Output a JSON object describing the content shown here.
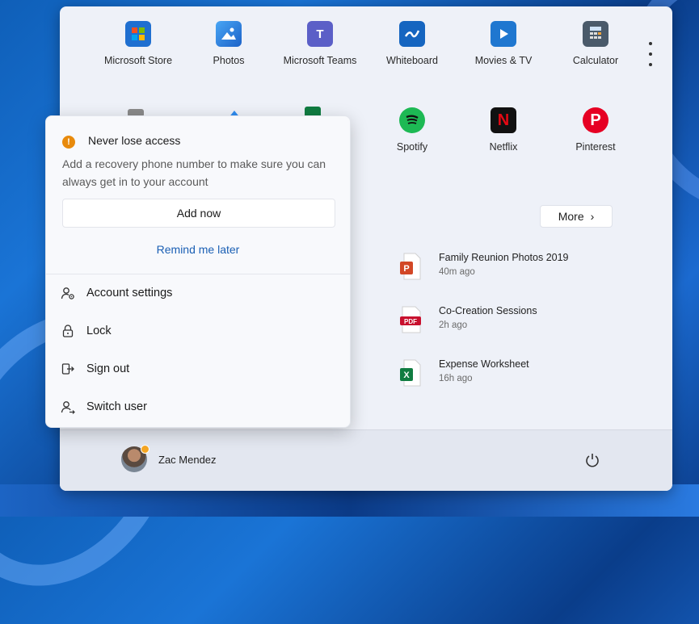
{
  "pinned_apps": [
    {
      "label": "Microsoft Store",
      "icon": "microsoft-store-icon",
      "color": "#1f6fd0"
    },
    {
      "label": "Photos",
      "icon": "photos-icon",
      "color": "#2b7fe0"
    },
    {
      "label": "Microsoft Teams",
      "icon": "teams-icon",
      "color": "#5b5fc7"
    },
    {
      "label": "Whiteboard",
      "icon": "whiteboard-icon",
      "color": "#1565c0"
    },
    {
      "label": "Movies & TV",
      "icon": "movies-tv-icon",
      "color": "#1f77d0"
    },
    {
      "label": "Calculator",
      "icon": "calculator-icon",
      "color": "#4a5a6a"
    },
    {
      "label": "Spotify",
      "icon": "spotify-icon",
      "color": "#1db954"
    },
    {
      "label": "Netflix",
      "icon": "netflix-icon",
      "color": "#e50914"
    },
    {
      "label": "Pinterest",
      "icon": "pinterest-icon",
      "color": "#e60023"
    }
  ],
  "more_button": {
    "label": "More",
    "icon": "chevron-right-icon"
  },
  "recommended": [
    {
      "name": "Family Reunion Photos 2019",
      "time": "40m ago",
      "icon": "powerpoint-file-icon"
    },
    {
      "name": "Co-Creation Sessions",
      "time": "2h ago",
      "icon": "pdf-file-icon"
    },
    {
      "name": "Expense Worksheet",
      "time": "16h ago",
      "icon": "excel-file-icon"
    }
  ],
  "user": {
    "name": "Zac Mendez"
  },
  "account_flyout": {
    "title": "Never lose access",
    "description": "Add a recovery phone number to make sure you can always get in to your account",
    "add_now": "Add now",
    "remind_later": "Remind me later",
    "menu": [
      {
        "label": "Account settings",
        "icon": "account-settings-icon"
      },
      {
        "label": "Lock",
        "icon": "lock-icon"
      },
      {
        "label": "Sign out",
        "icon": "sign-out-icon"
      },
      {
        "label": "Switch user",
        "icon": "switch-user-icon"
      }
    ]
  },
  "colors": {
    "accent": "#1a5fb4",
    "warning": "#e88a0c"
  }
}
